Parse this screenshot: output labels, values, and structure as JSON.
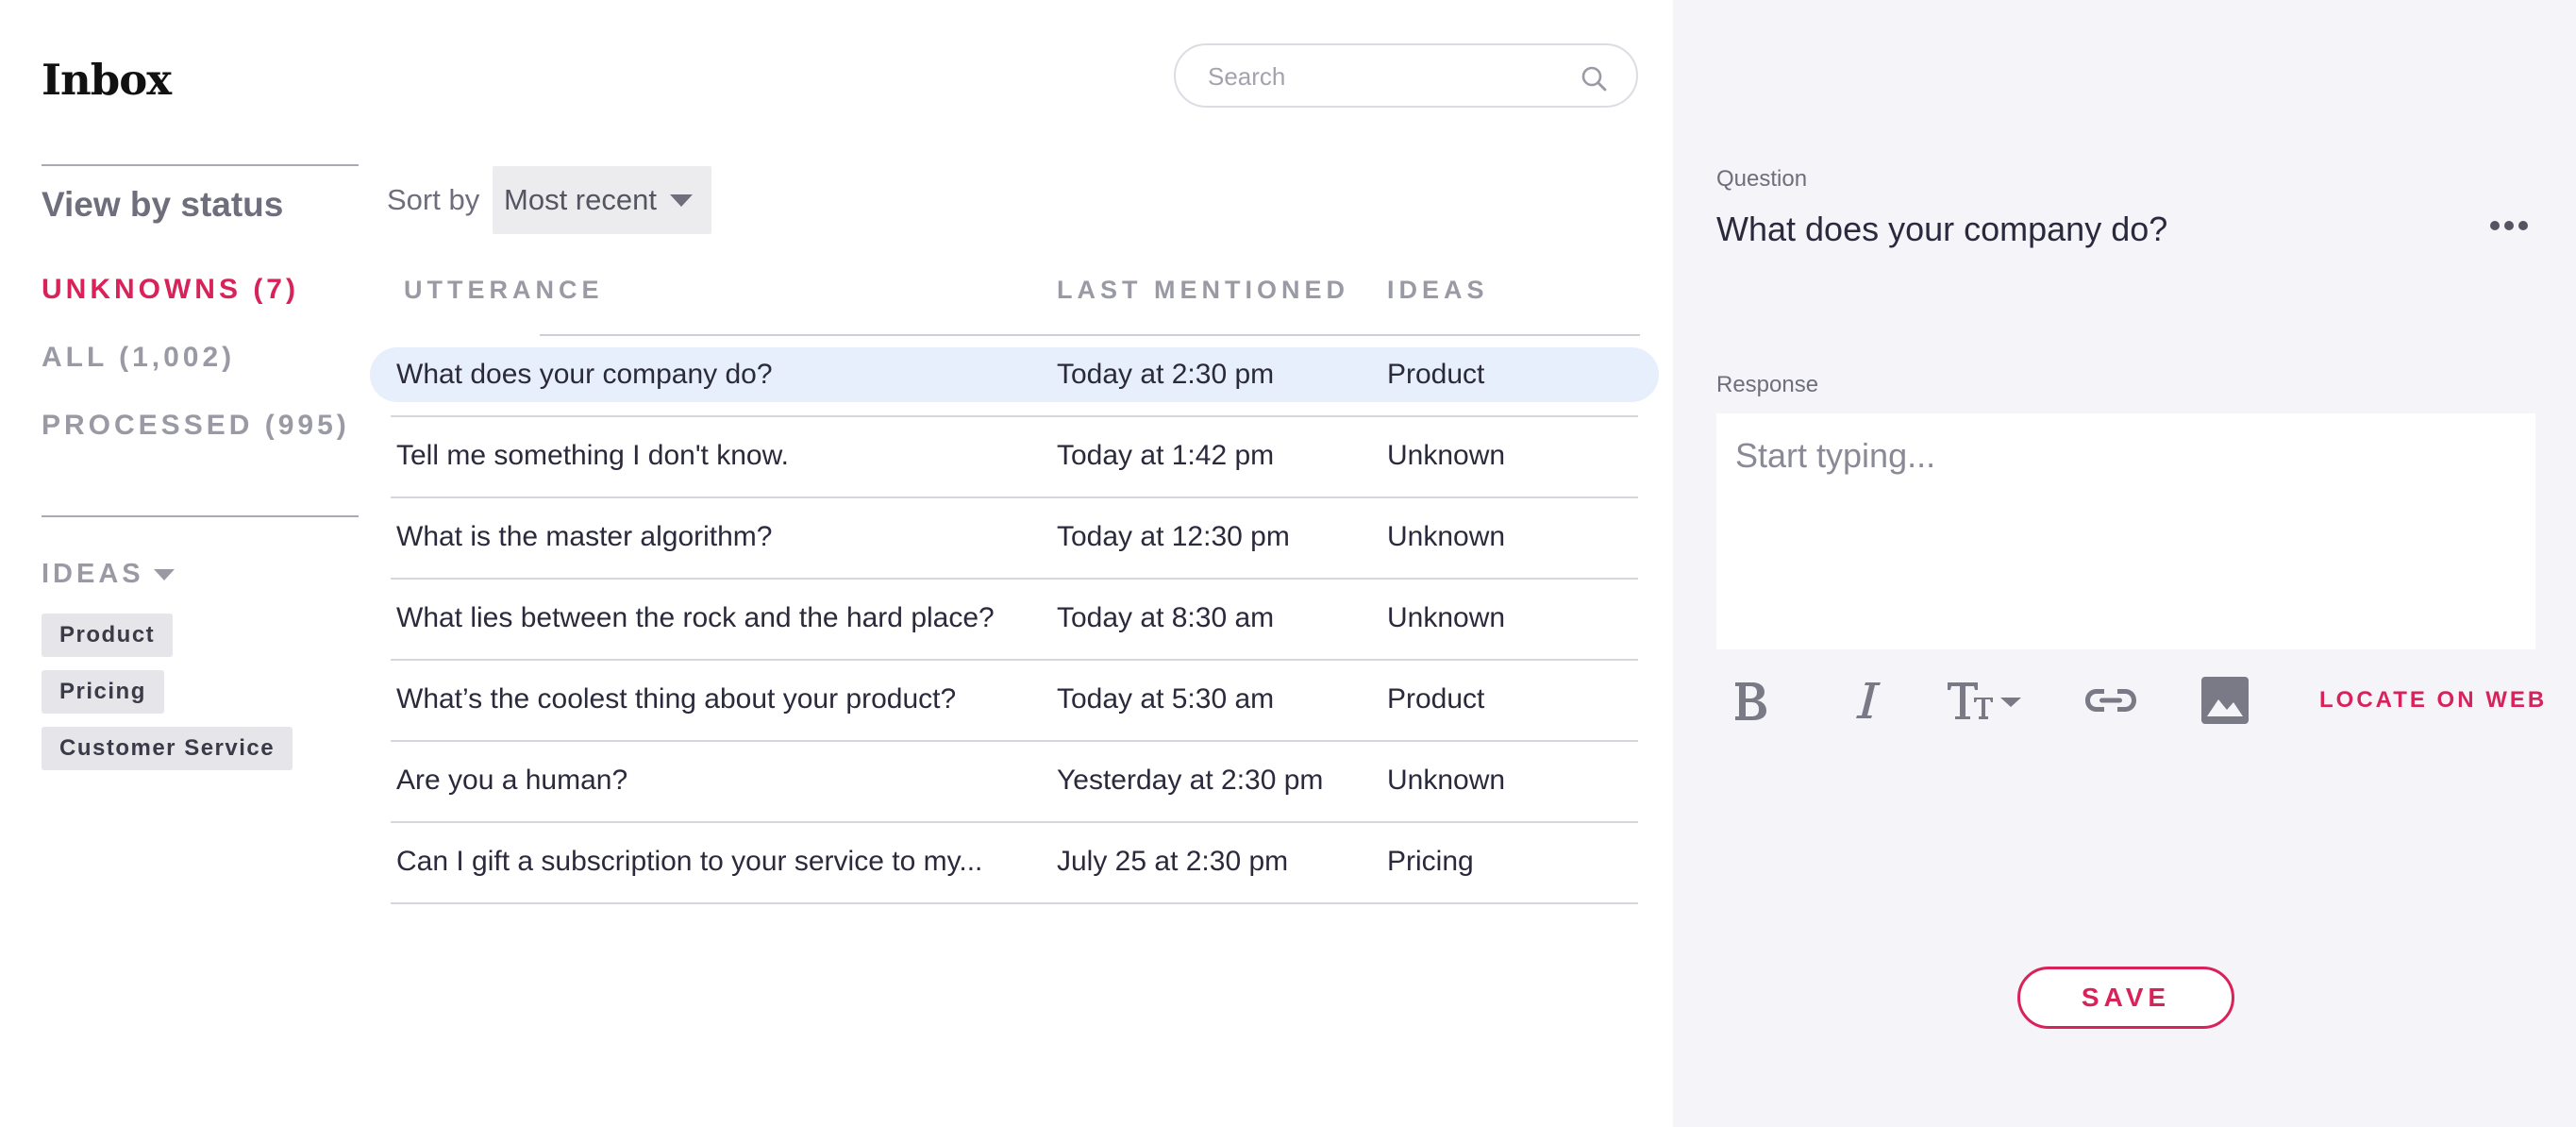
{
  "header": {
    "title": "Inbox"
  },
  "search": {
    "placeholder": "Search"
  },
  "sidebar": {
    "status_heading": "View by status",
    "statuses": [
      {
        "label": "UNKNOWNS (7)",
        "active": true
      },
      {
        "label": "ALL (1,002)",
        "active": false
      },
      {
        "label": "PROCESSED (995)",
        "active": false
      }
    ],
    "ideas_heading": "IDEAS",
    "tags": [
      "Product",
      "Pricing",
      "Customer Service"
    ]
  },
  "sort": {
    "label": "Sort by",
    "value": "Most recent"
  },
  "table": {
    "columns": [
      "UTTERANCE",
      "LAST MENTIONED",
      "IDEAS"
    ],
    "rows": [
      {
        "utterance": "What does your company do?",
        "last_mentioned": "Today at 2:30 pm",
        "idea": "Product",
        "selected": true
      },
      {
        "utterance": "Tell me something I don't know.",
        "last_mentioned": "Today at 1:42 pm",
        "idea": "Unknown"
      },
      {
        "utterance": "What is the master algorithm?",
        "last_mentioned": "Today at 12:30 pm",
        "idea": "Unknown"
      },
      {
        "utterance": "What lies between the rock and the hard place?",
        "last_mentioned": "Today at 8:30 am",
        "idea": "Unknown"
      },
      {
        "utterance": "What’s the coolest thing about your product?",
        "last_mentioned": "Today at 5:30 am",
        "idea": "Product"
      },
      {
        "utterance": "Are you a human?",
        "last_mentioned": "Yesterday at 2:30 pm",
        "idea": "Unknown"
      },
      {
        "utterance": "Can I gift a subscription to your service to my...",
        "last_mentioned": "July 25 at 2:30 pm",
        "idea": "Pricing"
      }
    ]
  },
  "detail": {
    "question_label": "Question",
    "question_text": "What does your company do?",
    "response_label": "Response",
    "response_placeholder": "Start typing...",
    "locate_label": "LOCATE ON WEB",
    "save_label": "SAVE",
    "toolbar_icons": [
      "bold-icon",
      "italic-icon",
      "text-size-icon",
      "link-icon",
      "image-icon"
    ]
  },
  "colors": {
    "accent": "#d9215a",
    "selected_row": "#e7eefc",
    "panel_bg": "#f5f4f9"
  }
}
